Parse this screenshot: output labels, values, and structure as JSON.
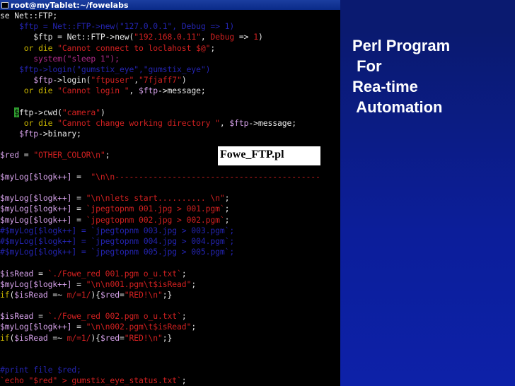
{
  "window": {
    "title": "root@myTablet:~/fowelabs"
  },
  "code_lines": [
    {
      "segments": [
        {
          "t": "se Net::FTP;",
          "c": "#e8e8e8"
        }
      ]
    },
    {
      "segments": [
        {
          "t": "    $ftp = Net::FTP->new(\"127.0.0.1\", Debug => 1)",
          "c": "#2424b0"
        }
      ]
    },
    {
      "segments": [
        {
          "t": "       $ftp = Net::FTP->",
          "c": "#e8e8e8"
        },
        {
          "t": "new",
          "c": "#e8e8e8"
        },
        {
          "t": "(",
          "c": "#e8e8e8"
        },
        {
          "t": "\"192.168.0.11\"",
          "c": "#d02020"
        },
        {
          "t": ", ",
          "c": "#e8e8e8"
        },
        {
          "t": "Debug",
          "c": "#d02020"
        },
        {
          "t": " => ",
          "c": "#e8e8e8"
        },
        {
          "t": "1",
          "c": "#d02020"
        },
        {
          "t": ")",
          "c": "#e8e8e8"
        }
      ]
    },
    {
      "segments": [
        {
          "t": "     ",
          "c": "#e8e8e8"
        },
        {
          "t": "or die",
          "c": "#c8b400"
        },
        {
          "t": " ",
          "c": "#e8e8e8"
        },
        {
          "t": "\"Cannot connect to loclahost $@\"",
          "c": "#d02020"
        },
        {
          "t": ";",
          "c": "#e8e8e8"
        }
      ]
    },
    {
      "segments": [
        {
          "t": "       system(\"sleep 1\");",
          "c": "#b02a8a"
        }
      ]
    },
    {
      "segments": [
        {
          "t": "    $ftp->login(\"gumstix_eye\",\"gumstix_eye\")",
          "c": "#2424b0"
        }
      ]
    },
    {
      "segments": [
        {
          "t": "       ",
          "c": "#e8e8e8"
        },
        {
          "t": "$ftp",
          "c": "#d4a0e8"
        },
        {
          "t": "->login(",
          "c": "#e8e8e8"
        },
        {
          "t": "\"ftpuser\"",
          "c": "#d02020"
        },
        {
          "t": ",",
          "c": "#e8e8e8"
        },
        {
          "t": "\"7fjaff7\"",
          "c": "#d02020"
        },
        {
          "t": ")",
          "c": "#e8e8e8"
        }
      ]
    },
    {
      "segments": [
        {
          "t": "     ",
          "c": "#e8e8e8"
        },
        {
          "t": "or die",
          "c": "#c8b400"
        },
        {
          "t": " ",
          "c": "#e8e8e8"
        },
        {
          "t": "\"Cannot login \"",
          "c": "#d02020"
        },
        {
          "t": ", ",
          "c": "#e8e8e8"
        },
        {
          "t": "$ftp",
          "c": "#d4a0e8"
        },
        {
          "t": "->message;",
          "c": "#e8e8e8"
        }
      ]
    },
    {
      "segments": [
        {
          "t": "",
          "c": "#e8e8e8"
        }
      ]
    },
    {
      "segments": [
        {
          "t": "   ",
          "c": "#e8e8e8"
        },
        {
          "t": "$",
          "c": "#000000",
          "cursor": true
        },
        {
          "t": "ftp->cwd(",
          "c": "#e8e8e8"
        },
        {
          "t": "\"camera\"",
          "c": "#d02020"
        },
        {
          "t": ")",
          "c": "#e8e8e8"
        }
      ]
    },
    {
      "segments": [
        {
          "t": "     ",
          "c": "#e8e8e8"
        },
        {
          "t": "or die",
          "c": "#c8b400"
        },
        {
          "t": " ",
          "c": "#e8e8e8"
        },
        {
          "t": "\"Cannot change working directory \"",
          "c": "#d02020"
        },
        {
          "t": ", ",
          "c": "#e8e8e8"
        },
        {
          "t": "$ftp",
          "c": "#d4a0e8"
        },
        {
          "t": "->message;",
          "c": "#e8e8e8"
        }
      ]
    },
    {
      "segments": [
        {
          "t": "    ",
          "c": "#e8e8e8"
        },
        {
          "t": "$ftp",
          "c": "#d4a0e8"
        },
        {
          "t": "->binary;",
          "c": "#e8e8e8"
        }
      ]
    },
    {
      "segments": [
        {
          "t": "",
          "c": "#e8e8e8"
        }
      ]
    },
    {
      "segments": [
        {
          "t": "$red",
          "c": "#d4a0e8"
        },
        {
          "t": " = ",
          "c": "#e8e8e8"
        },
        {
          "t": "\"OTHER_COLOR\\n\"",
          "c": "#d02020"
        },
        {
          "t": ";",
          "c": "#e8e8e8"
        }
      ]
    },
    {
      "segments": [
        {
          "t": "",
          "c": "#e8e8e8"
        }
      ]
    },
    {
      "segments": [
        {
          "t": "$myLog[$logk++]",
          "c": "#d4a0e8"
        },
        {
          "t": " =  ",
          "c": "#e8e8e8"
        },
        {
          "t": "\"\\n\\n-------------------------------------------",
          "c": "#d02020"
        }
      ]
    },
    {
      "segments": [
        {
          "t": "",
          "c": "#e8e8e8"
        }
      ]
    },
    {
      "segments": [
        {
          "t": "$myLog[$logk++]",
          "c": "#d4a0e8"
        },
        {
          "t": " = ",
          "c": "#e8e8e8"
        },
        {
          "t": "\"\\n\\nlets start.......... \\n\"",
          "c": "#d02020"
        },
        {
          "t": ";",
          "c": "#e8e8e8"
        }
      ]
    },
    {
      "segments": [
        {
          "t": "$myLog[$logk++]",
          "c": "#d4a0e8"
        },
        {
          "t": " = ",
          "c": "#e8e8e8"
        },
        {
          "t": "`jpegtopnm 001.jpg > 001.pgm`",
          "c": "#d02020"
        },
        {
          "t": ";",
          "c": "#e8e8e8"
        }
      ]
    },
    {
      "segments": [
        {
          "t": "$myLog[$logk++]",
          "c": "#d4a0e8"
        },
        {
          "t": " = ",
          "c": "#e8e8e8"
        },
        {
          "t": "`jpegtopnm 002.jpg > 002.pgm`",
          "c": "#d02020"
        },
        {
          "t": ";",
          "c": "#e8e8e8"
        }
      ]
    },
    {
      "segments": [
        {
          "t": "#$myLog[$logk++] = `jpegtopnm 003.jpg > 003.pgm`;",
          "c": "#2424b0"
        }
      ]
    },
    {
      "segments": [
        {
          "t": "#$myLog[$logk++] = `jpegtopnm 004.jpg > 004.pgm`;",
          "c": "#2424b0"
        }
      ]
    },
    {
      "segments": [
        {
          "t": "#$myLog[$logk++] = `jpegtopnm 005.jpg > 005.pgm`;",
          "c": "#2424b0"
        }
      ]
    },
    {
      "segments": [
        {
          "t": "",
          "c": "#e8e8e8"
        }
      ]
    },
    {
      "segments": [
        {
          "t": "$isRead",
          "c": "#d4a0e8"
        },
        {
          "t": " = ",
          "c": "#e8e8e8"
        },
        {
          "t": "`./Fowe_red 001.pgm o_u.txt`",
          "c": "#d02020"
        },
        {
          "t": ";",
          "c": "#e8e8e8"
        }
      ]
    },
    {
      "segments": [
        {
          "t": "$myLog[$logk++]",
          "c": "#d4a0e8"
        },
        {
          "t": " = ",
          "c": "#e8e8e8"
        },
        {
          "t": "\"\\n\\n001.pgm\\t$isRead\"",
          "c": "#d02020"
        },
        {
          "t": ";",
          "c": "#e8e8e8"
        }
      ]
    },
    {
      "segments": [
        {
          "t": "if",
          "c": "#c8b400"
        },
        {
          "t": "(",
          "c": "#e8e8e8"
        },
        {
          "t": "$isRead",
          "c": "#d4a0e8"
        },
        {
          "t": " =~ ",
          "c": "#e8e8e8"
        },
        {
          "t": "m/=1/",
          "c": "#d02020"
        },
        {
          "t": "){",
          "c": "#e8e8e8"
        },
        {
          "t": "$red",
          "c": "#d4a0e8"
        },
        {
          "t": "=",
          "c": "#e8e8e8"
        },
        {
          "t": "\"RED!\\n\"",
          "c": "#d02020"
        },
        {
          "t": ";}",
          "c": "#e8e8e8"
        }
      ]
    },
    {
      "segments": [
        {
          "t": "",
          "c": "#e8e8e8"
        }
      ]
    },
    {
      "segments": [
        {
          "t": "$isRead",
          "c": "#d4a0e8"
        },
        {
          "t": " = ",
          "c": "#e8e8e8"
        },
        {
          "t": "`./Fowe_red 002.pgm o_u.txt`",
          "c": "#d02020"
        },
        {
          "t": ";",
          "c": "#e8e8e8"
        }
      ]
    },
    {
      "segments": [
        {
          "t": "$myLog[$logk++]",
          "c": "#d4a0e8"
        },
        {
          "t": " = ",
          "c": "#e8e8e8"
        },
        {
          "t": "\"\\n\\n002.pgm\\t$isRead\"",
          "c": "#d02020"
        },
        {
          "t": ";",
          "c": "#e8e8e8"
        }
      ]
    },
    {
      "segments": [
        {
          "t": "if",
          "c": "#c8b400"
        },
        {
          "t": "(",
          "c": "#e8e8e8"
        },
        {
          "t": "$isRead",
          "c": "#d4a0e8"
        },
        {
          "t": " =~ ",
          "c": "#e8e8e8"
        },
        {
          "t": "m/=1/",
          "c": "#d02020"
        },
        {
          "t": "){",
          "c": "#e8e8e8"
        },
        {
          "t": "$red",
          "c": "#d4a0e8"
        },
        {
          "t": "=",
          "c": "#e8e8e8"
        },
        {
          "t": "\"RED!\\n\"",
          "c": "#d02020"
        },
        {
          "t": ";}",
          "c": "#e8e8e8"
        }
      ]
    },
    {
      "segments": [
        {
          "t": "",
          "c": "#e8e8e8"
        }
      ]
    },
    {
      "segments": [
        {
          "t": "",
          "c": "#e8e8e8"
        }
      ]
    },
    {
      "segments": [
        {
          "t": "#print file $red;",
          "c": "#2424b0"
        }
      ]
    },
    {
      "segments": [
        {
          "t": "`echo \"$red\" > gumstix_eye_status.txt`",
          "c": "#d02020"
        },
        {
          "t": ";",
          "c": "#e8e8e8"
        }
      ]
    }
  ],
  "file_label": "Fowe_FTP.pl",
  "slide": {
    "title_lines": [
      "Perl Program",
      " For",
      "Rea-time",
      " Automation"
    ]
  }
}
